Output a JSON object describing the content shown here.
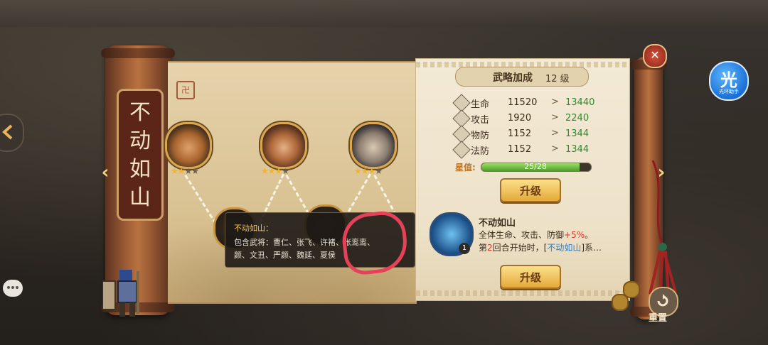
{
  "scroll_title": [
    "不",
    "动",
    "如",
    "山"
  ],
  "helper_badge": {
    "glyph": "光",
    "label": "光环助手"
  },
  "heroes": [
    {
      "stars_on": 2,
      "stars_total": 4
    },
    {
      "stars_on": 3,
      "stars_total": 4
    },
    {
      "stars_on": 3,
      "stars_total": 4
    }
  ],
  "tooltip": {
    "title": "不动如山：",
    "line1": "包含武将：曹仁、张飞、许褚、张鸾鸾、",
    "line2": "颜、文丑、严颜、魏延、夏侯"
  },
  "bonus": {
    "header": "武略加成",
    "level": "12 级",
    "stats": [
      {
        "icon": "health-icon",
        "label": "生命",
        "current": "11520",
        "arrow": ">",
        "next": "13440"
      },
      {
        "icon": "attack-icon",
        "label": "攻击",
        "current": "1920",
        "arrow": ">",
        "next": "2240"
      },
      {
        "icon": "armor-icon",
        "label": "物防",
        "current": "1152",
        "arrow": ">",
        "next": "1344"
      },
      {
        "icon": "magic-defense-icon",
        "label": "法防",
        "current": "1152",
        "arrow": ">",
        "next": "1344"
      }
    ],
    "star_label": "星值:",
    "star_progress_text": "25/28",
    "star_progress": 0.893,
    "upgrade_label": "升级"
  },
  "skill": {
    "name": "不动如山",
    "badge": "1",
    "desc1_a": "全体生命、攻击、防御",
    "desc1_b": "+5%",
    "desc1_c": "。",
    "desc2_a": "第",
    "desc2_b": "2",
    "desc2_c": "回合开始时，[",
    "desc2_d": "不动如山",
    "desc2_e": "]系…",
    "upgrade_label": "升级"
  },
  "close_glyph": "✕",
  "reset_label": "重置",
  "nav": {
    "left": "‹",
    "right": "›"
  },
  "colors": {
    "accent_gold": "#e4a93a",
    "stat_next": "#2e8a2e",
    "annotation": "#e54158"
  }
}
